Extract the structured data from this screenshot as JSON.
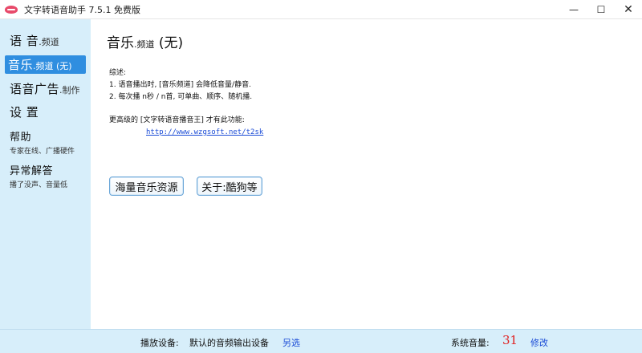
{
  "window": {
    "title": "文字转语音助手 7.5.1 免费版",
    "controls": {
      "minimize": "—",
      "maximize": "☐",
      "close": "✕"
    }
  },
  "sidebar": {
    "items": [
      {
        "big": "语 音",
        "small": ".频道",
        "sub": ""
      },
      {
        "big": "音乐",
        "small": ".频道 (无)",
        "sub": ""
      },
      {
        "big": "语音广告",
        "small": ".制作",
        "sub": ""
      },
      {
        "big": "设 置",
        "small": "",
        "sub": ""
      },
      {
        "big": "帮助",
        "small": "",
        "sub": "专家在线、广播硬件"
      },
      {
        "big": "异常解答",
        "small": "",
        "sub": "播了没声、音量低"
      }
    ]
  },
  "main": {
    "title_big": "音乐",
    "title_small": ".频道",
    "title_suffix": " (无)",
    "desc": {
      "heading": "综述:",
      "line1": "1. 语音播出时, [音乐频道] 会降低音量/静音.",
      "line2": "2. 每次播 n秒 / n首, 可单曲、顺序、随机播.",
      "promo": "更高级的 [文字转语音播音王] 才有此功能:",
      "link": "http://www.wzgsoft.net/t2sk"
    },
    "buttons": {
      "resources": "海量音乐资源",
      "about": "关于:酷狗等"
    }
  },
  "statusbar": {
    "device_label": "播放设备:",
    "device_value": "默认的音频输出设备",
    "device_link": "另选",
    "volume_label": "系统音量:",
    "volume_value": "31",
    "volume_link": "修改"
  }
}
